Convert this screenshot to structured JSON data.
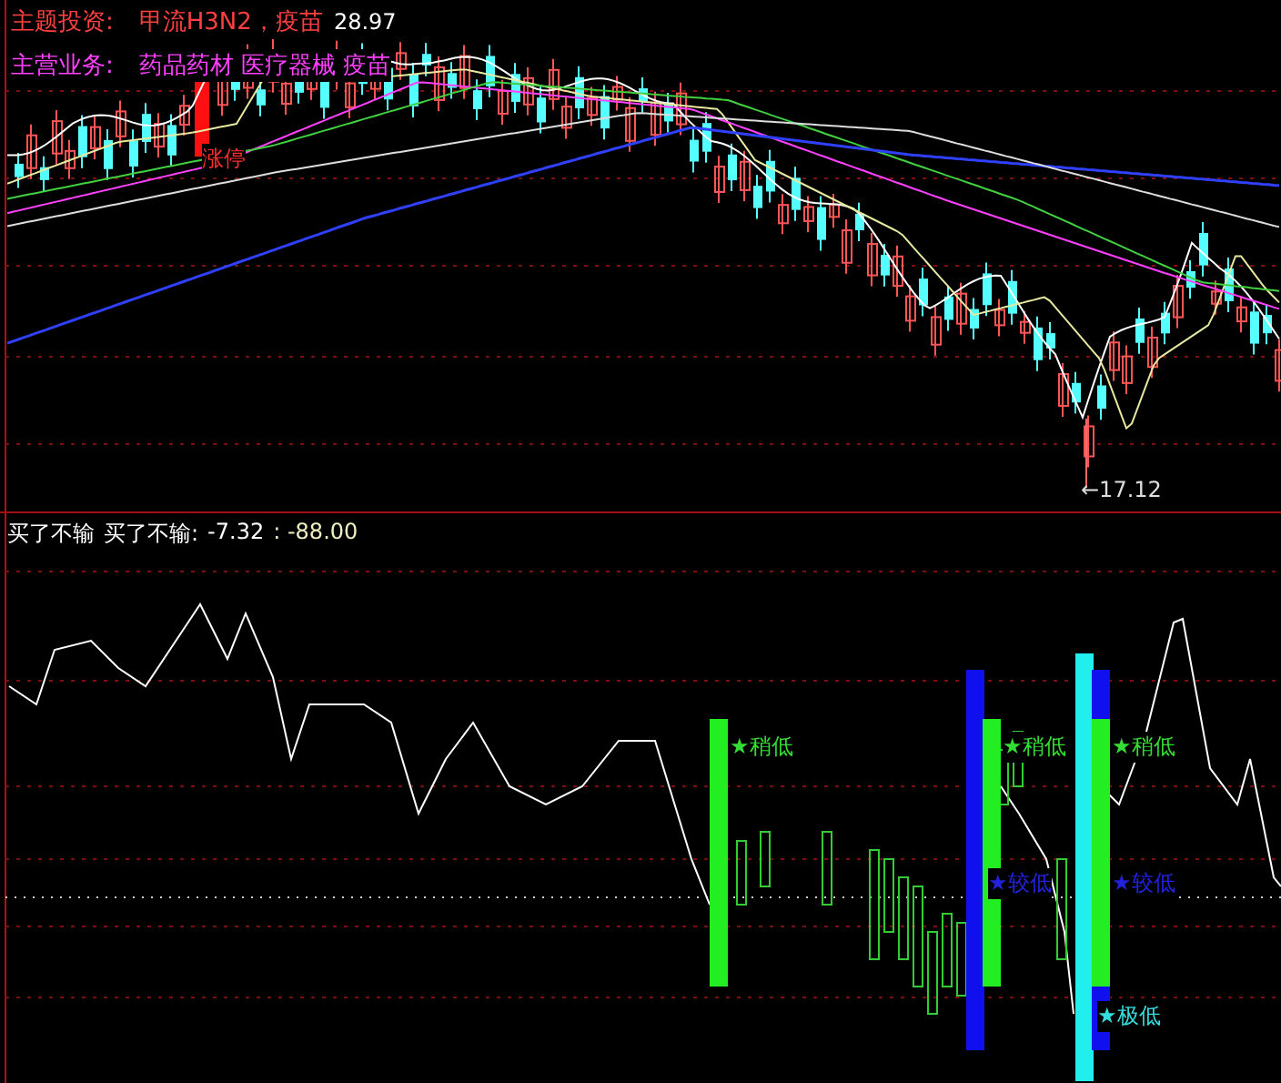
{
  "price_panel": {
    "info_lines": [
      {
        "label": "主题投资:",
        "value": "甲流H3N2，疫苗"
      },
      {
        "label": "主营业务:",
        "value": "药品药材 医疗器械 疫苗"
      }
    ],
    "price_reading": "28.97",
    "limit_up_label": "涨停",
    "low_label": "←17.12"
  },
  "indicator_panel": {
    "title": "买了不输",
    "reading_name": "买了不输:",
    "reading": "-7.32",
    "reading_2": ": -88.00",
    "signal_bars": [
      {
        "color": "#22ee22"
      },
      {
        "color": "#1010ee"
      },
      {
        "color": "#22ee22"
      },
      {
        "color": "#22eeee"
      },
      {
        "color": "#1010ee"
      },
      {
        "color": "#22ee22"
      }
    ],
    "signal_labels": [
      {
        "text": "★稍低",
        "color": "#33dd33"
      },
      {
        "text": "★稍低",
        "color": "#33dd33"
      },
      {
        "text": "★较低",
        "color": "#2222dd"
      },
      {
        "text": "★稍低",
        "color": "#33dd33"
      },
      {
        "text": "★较低",
        "color": "#2222dd"
      },
      {
        "text": "★极低",
        "color": "#33dddd"
      }
    ]
  }
}
